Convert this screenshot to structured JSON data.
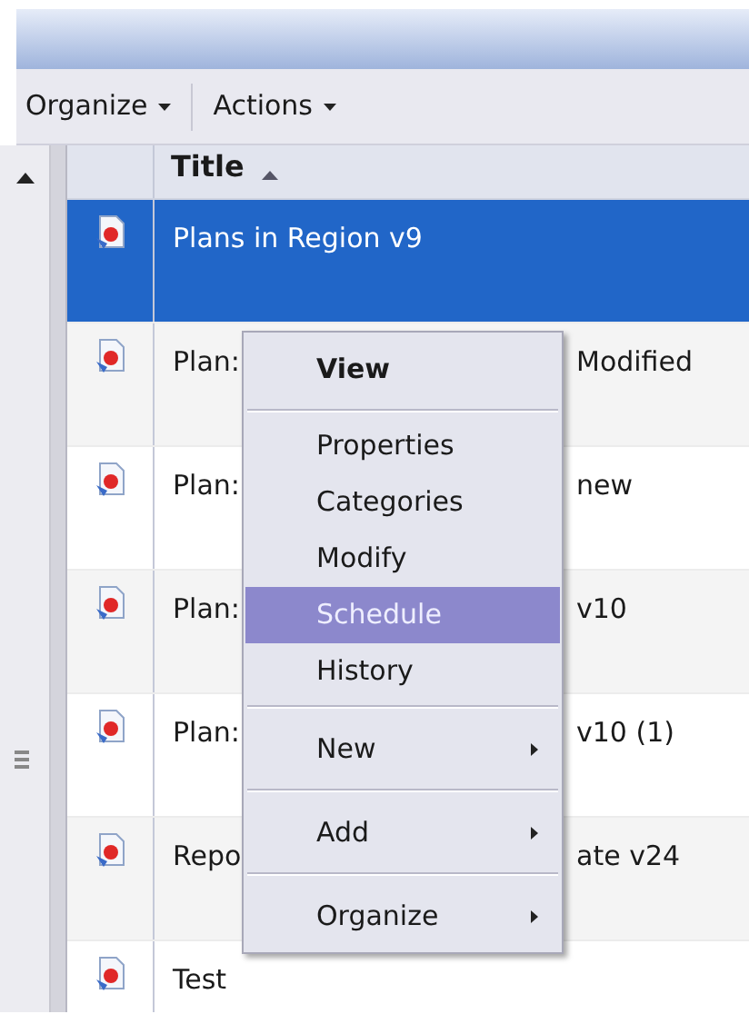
{
  "toolbar": {
    "buttons": [
      {
        "label": "Organize"
      },
      {
        "label": "Actions"
      }
    ]
  },
  "table": {
    "columns": [
      {
        "label": "Title",
        "sorted": true
      }
    ],
    "rows": [
      {
        "title_start": "Plans in Region v9",
        "selected": true
      },
      {
        "title_start": "Plan:",
        "title_end": "Modified",
        "selected": false
      },
      {
        "title_start": "Plan:",
        "title_end": "new",
        "selected": false
      },
      {
        "title_start": "Plan:",
        "title_end": "v10",
        "selected": false
      },
      {
        "title_start": "Plan:",
        "title_end": "v10 (1)",
        "selected": false
      },
      {
        "title_start": "Repo",
        "title_end": "ate v24",
        "selected": false
      },
      {
        "title_start": "Test",
        "selected": false
      }
    ]
  },
  "context_menu": {
    "groups": [
      [
        {
          "label": "View",
          "kind": "default",
          "selected": false
        }
      ],
      [
        {
          "label": "Properties",
          "kind": "item",
          "selected": false
        },
        {
          "label": "Categories",
          "kind": "item",
          "selected": false
        },
        {
          "label": "Modify",
          "kind": "item",
          "selected": false
        },
        {
          "label": "Schedule",
          "kind": "item",
          "selected": true
        },
        {
          "label": "History",
          "kind": "item",
          "selected": false
        }
      ],
      [
        {
          "label": "New",
          "kind": "submenu",
          "selected": false
        }
      ],
      [
        {
          "label": "Add",
          "kind": "submenu",
          "selected": false
        }
      ],
      [
        {
          "label": "Organize",
          "kind": "submenu",
          "selected": false
        }
      ]
    ]
  }
}
